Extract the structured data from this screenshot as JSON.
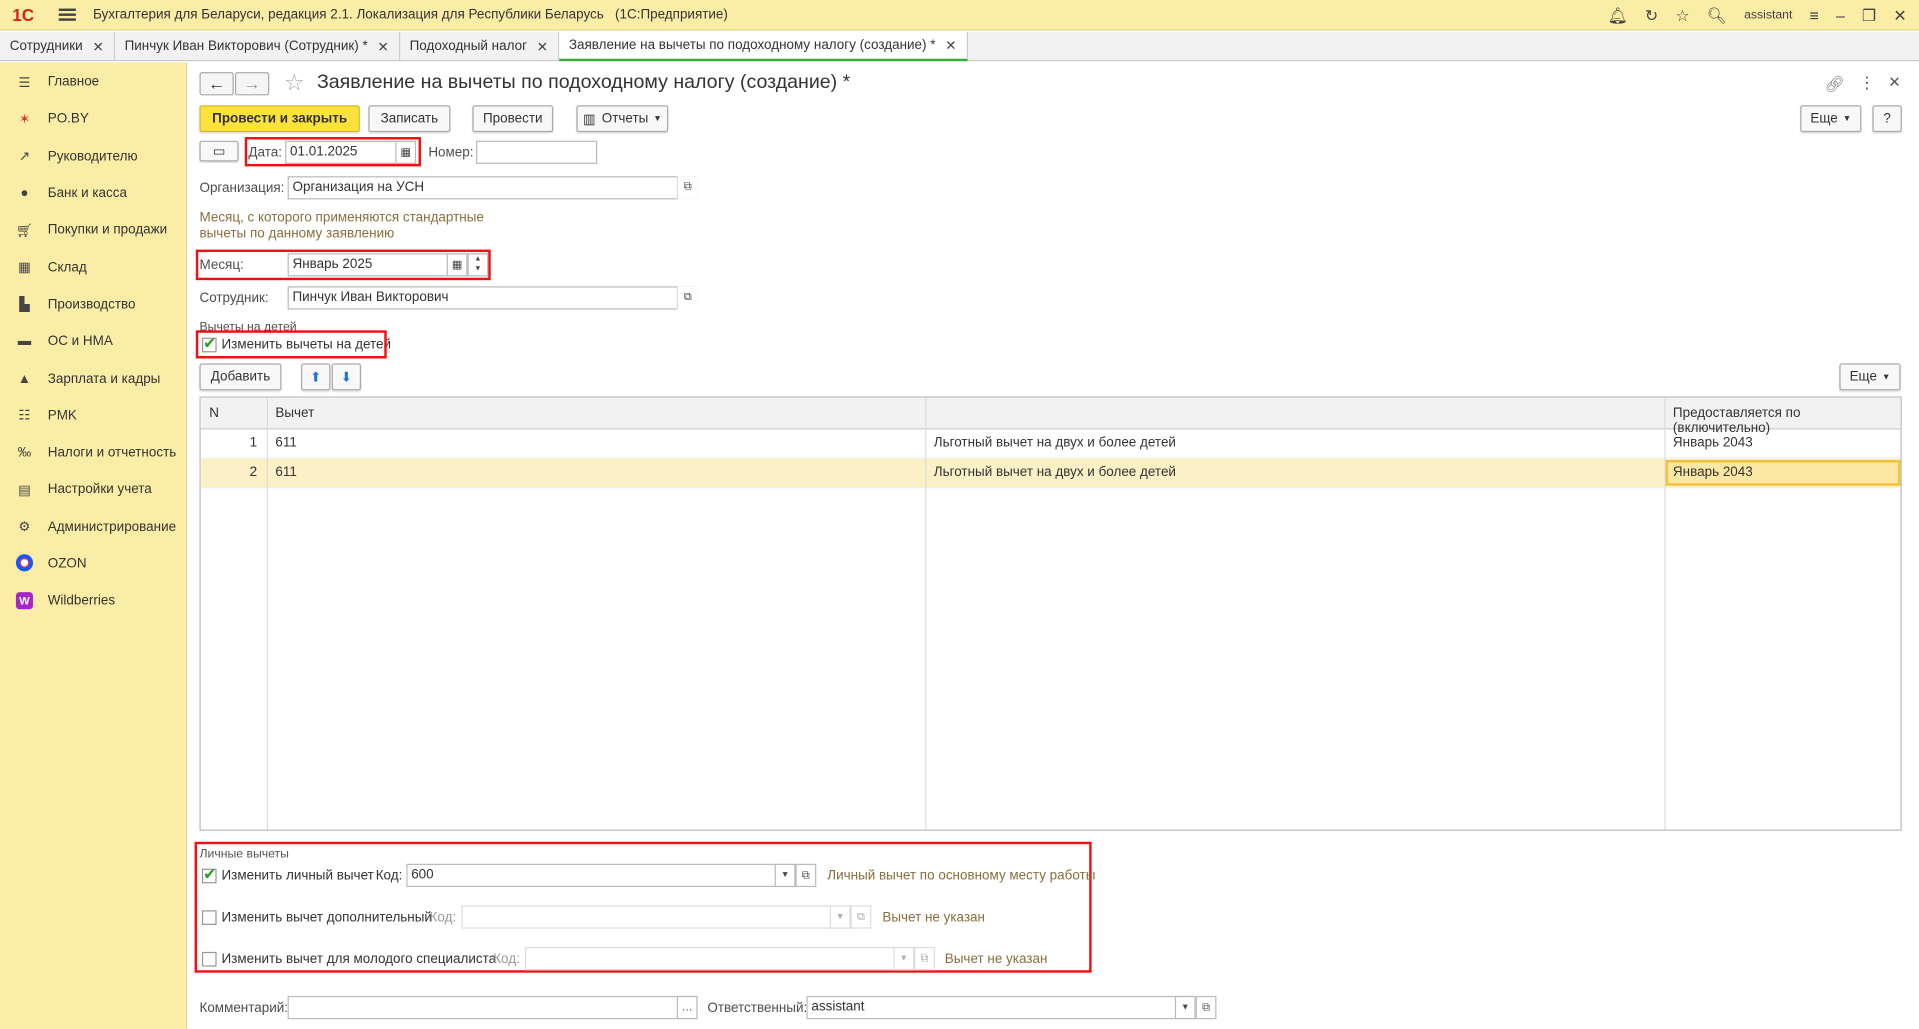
{
  "app": {
    "logo": "1С",
    "title": "Бухгалтерия для Беларуси, редакция 2.1. Локализация для Республики Беларусь",
    "platform": "(1С:Предприятие)",
    "user": "assistant"
  },
  "tabs": [
    {
      "label": "Сотрудники"
    },
    {
      "label": "Пинчук Иван Викторович (Сотрудник) *"
    },
    {
      "label": "Подоходный налог"
    },
    {
      "label": "Заявление на вычеты по подоходному налогу (создание) *"
    }
  ],
  "sidebar": {
    "items": [
      {
        "label": "Главное",
        "icon": "menu-icon"
      },
      {
        "label": "PO.BY",
        "icon": "poby-icon"
      },
      {
        "label": "Руководителю",
        "icon": "chart-line-icon"
      },
      {
        "label": "Банк и касса",
        "icon": "bank-icon"
      },
      {
        "label": "Покупки и продажи",
        "icon": "cart-icon"
      },
      {
        "label": "Склад",
        "icon": "warehouse-icon"
      },
      {
        "label": "Производство",
        "icon": "production-icon"
      },
      {
        "label": "ОС и НМА",
        "icon": "truck-icon"
      },
      {
        "label": "Зарплата и кадры",
        "icon": "person-icon"
      },
      {
        "label": "PMK",
        "icon": "pmk-icon"
      },
      {
        "label": "Налоги и отчетность",
        "icon": "taxes-icon"
      },
      {
        "label": "Настройки учета",
        "icon": "settings-doc-icon"
      },
      {
        "label": "Администрирование",
        "icon": "gear-icon"
      },
      {
        "label": "OZON",
        "icon": "ozon-icon"
      },
      {
        "label": "Wildberries",
        "icon": "wildberries-icon"
      }
    ]
  },
  "form": {
    "title": "Заявление на вычеты по подоходному налогу (создание) *",
    "buttons": {
      "post_close": "Провести и закрыть",
      "save": "Записать",
      "post": "Провести",
      "reports": "Отчеты",
      "more": "Еще",
      "help": "?"
    },
    "date_label": "Дата:",
    "date_value": "01.01.2025",
    "number_label": "Номер:",
    "number_value": "",
    "org_label": "Организация:",
    "org_value": "Организация на УСН",
    "month_hint": "Месяц, с которого применяются стандартные вычеты по данному заявлению",
    "month_label": "Месяц:",
    "month_value": "Январь 2025",
    "employee_label": "Сотрудник:",
    "employee_value": "Пинчук Иван Викторович",
    "children_group": "Вычеты на детей",
    "change_children": "Изменить вычеты на детей",
    "add_button": "Добавить",
    "table_more": "Еще",
    "table": {
      "headers": [
        "N",
        "Вычет",
        "",
        "Предоставляется по (включительно)"
      ],
      "rows": [
        [
          "1",
          "611",
          "Льготный вычет на двух и более детей",
          "Январь 2043"
        ],
        [
          "2",
          "611",
          "Льготный вычет на двух и более детей",
          "Январь 2043"
        ]
      ]
    },
    "personal_group": "Личные вычеты",
    "personal": {
      "change_personal": "Изменить личный вычет",
      "code_label": "Код:",
      "personal_code": "600",
      "personal_desc": "Личный вычет по основному месту работы",
      "change_additional": "Изменить вычет дополнительный",
      "additional_code": "",
      "additional_desc": "Вычет не указан",
      "change_young": "Изменить вычет для молодого специалиста",
      "young_code": "",
      "young_desc": "Вычет не указан"
    },
    "comment_label": "Комментарий:",
    "comment_value": "",
    "responsible_label": "Ответственный:",
    "responsible_value": "assistant"
  }
}
